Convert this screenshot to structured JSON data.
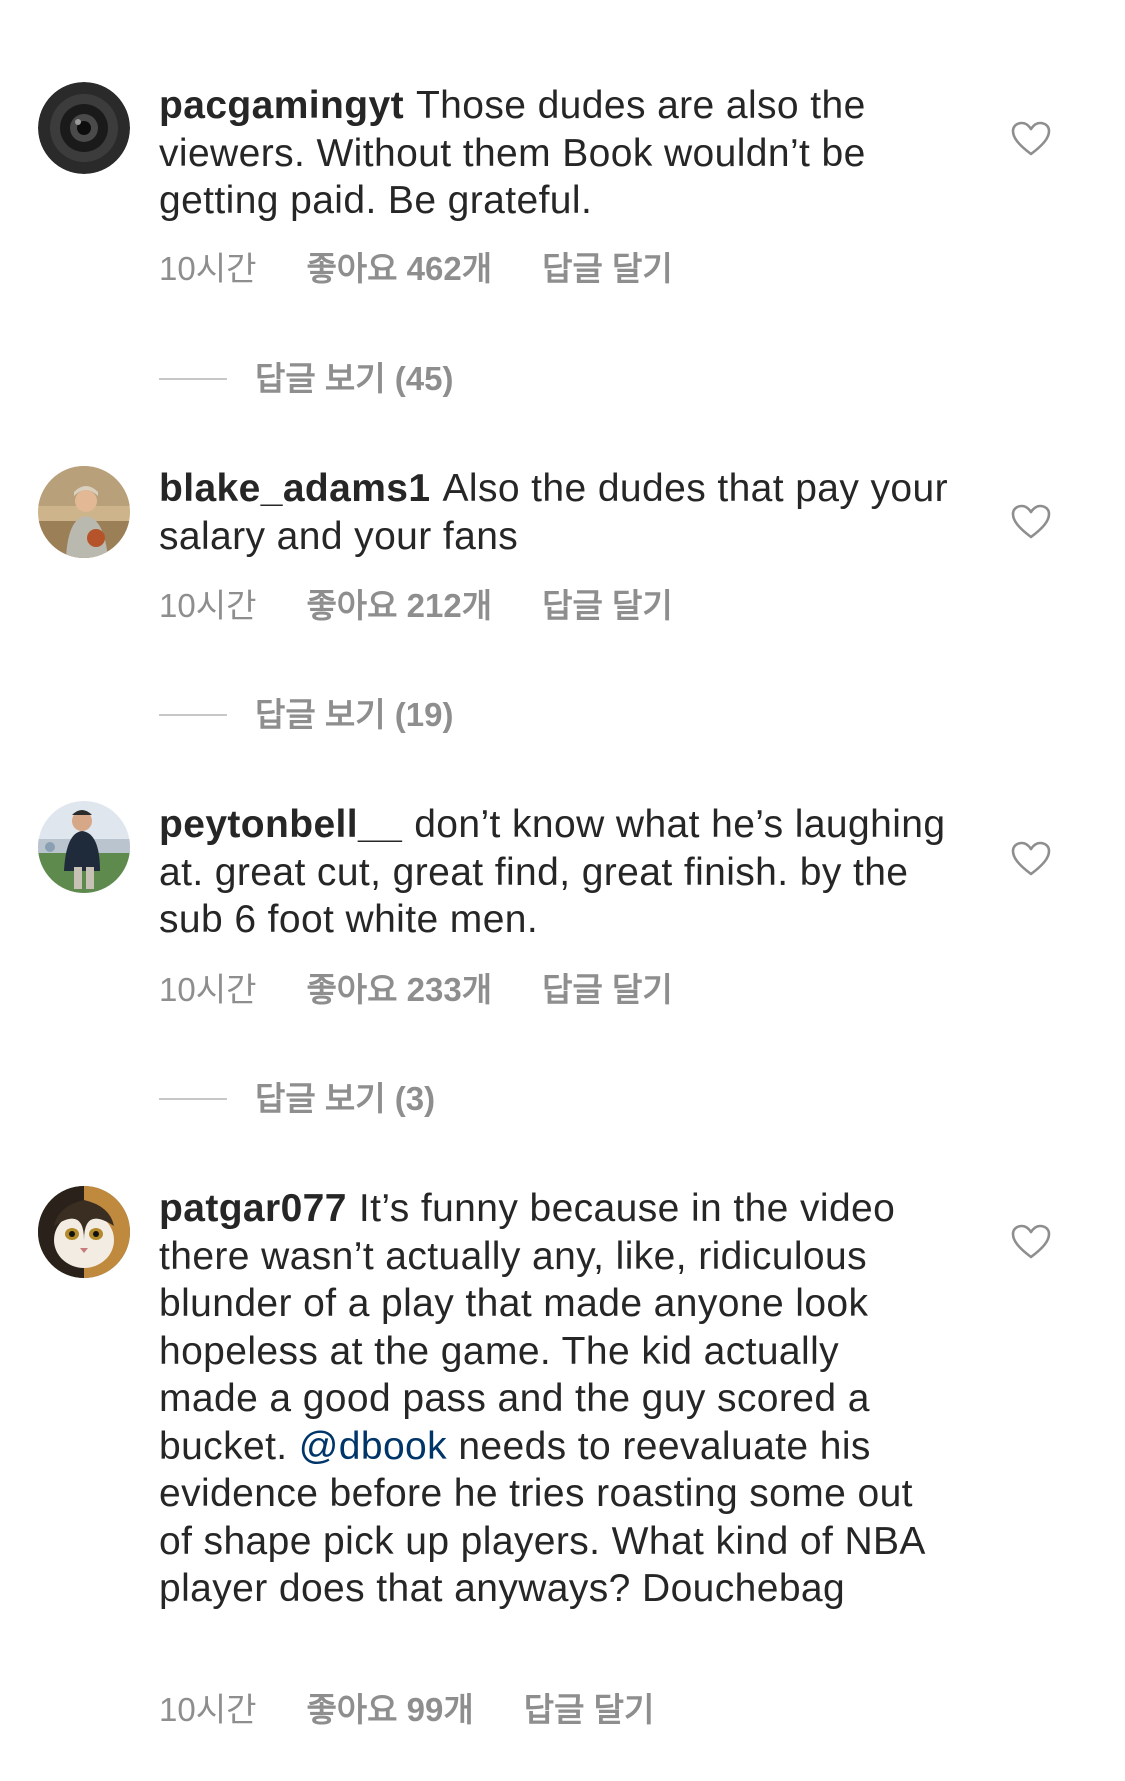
{
  "comments": [
    {
      "username": "pacgamingyt",
      "text": "Those dudes are also the viewers. Without them Book wouldn’t be getting paid. Be grateful.",
      "time": "10시간",
      "likes": "좋아요 462개",
      "reply": "답글 달기",
      "view_replies": "답글 보기 (45)"
    },
    {
      "username": "blake_adams1",
      "text": "Also the dudes that pay your salary and your fans",
      "time": "10시간",
      "likes": "좋아요 212개",
      "reply": "답글 달기",
      "view_replies": "답글 보기 (19)"
    },
    {
      "username": "peytonbell__",
      "text": "don’t know what he’s laughing at. great cut, great find, great finish. by the sub 6 foot white men.",
      "time": "10시간",
      "likes": "좋아요 233개",
      "reply": "답글 달기",
      "view_replies": "답글 보기 (3)"
    },
    {
      "username": "patgar077",
      "text_before": "It’s funny because in the video there wasn’t actually any, like, ridiculous blunder of a play that made anyone look hopeless at the game. The kid actually made a good pass and the guy scored a bucket.",
      "mention": "@dbook",
      "text_after": "needs to reevaluate his evidence before he tries roasting some out of shape pick up players. What kind of NBA player does that anyways? Douchebag",
      "time": "10시간",
      "likes": "좋아요 99개",
      "reply": "답글 달기"
    }
  ],
  "icons": {
    "like": "heart-outline-icon"
  },
  "colors": {
    "text": "#262626",
    "secondary": "#8e8e8e",
    "mention": "#003569"
  }
}
